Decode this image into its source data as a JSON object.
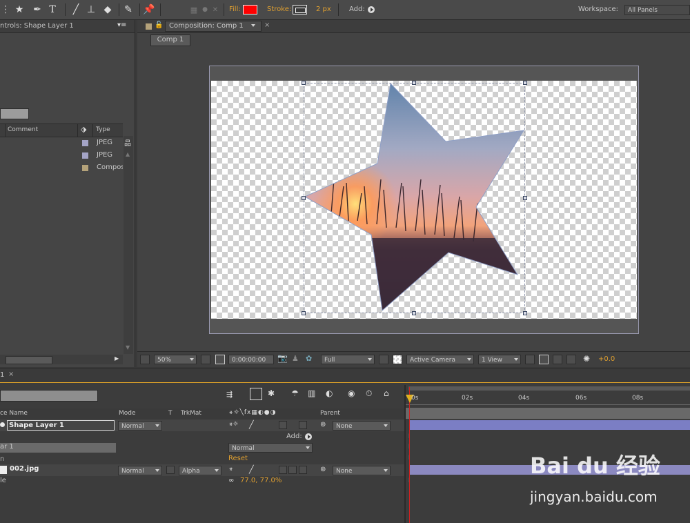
{
  "toolbar": {
    "fill_label": "Fill:",
    "fill_color": "#ff0000",
    "stroke_label": "Stroke:",
    "stroke_width": "2 px",
    "add_label": "Add:",
    "workspace_label": "Workspace:",
    "workspace_value": "All Panels",
    "tools": [
      "star-tool-icon",
      "pen-tool-icon",
      "type-tool-icon",
      "brush-tool-icon",
      "clone-stamp-icon",
      "eraser-icon",
      "roto-brush-icon",
      "puppet-pin-icon"
    ]
  },
  "effect_controls": {
    "title": "ntrols: Shape Layer 1"
  },
  "project": {
    "columns": {
      "comment": "Comment",
      "type": "Type"
    },
    "items": [
      {
        "type": "JPEG",
        "color": "#a4a4c6"
      },
      {
        "type": "JPEG",
        "color": "#a4a4c6"
      },
      {
        "type": "Compos",
        "color": "#b4a27a"
      }
    ]
  },
  "composition": {
    "tab_title": "Composition: Comp 1",
    "breadcrumb": "Comp 1",
    "zoom": "50%",
    "timecode": "0:00:00:00",
    "resolution": "Full",
    "camera": "Active Camera",
    "view": "1 View",
    "exposure": "+0.0"
  },
  "timeline": {
    "tab": "1",
    "headers": {
      "name": "ce Name",
      "mode": "Mode",
      "t": "T",
      "trkmat": "TrkMat",
      "parent": "Parent"
    },
    "layers": [
      {
        "name": "Shape Layer 1",
        "mode": "Normal",
        "parent": "None"
      },
      {
        "name": "002.jpg",
        "mode": "Normal",
        "trkmat": "Alpha",
        "parent": "None"
      }
    ],
    "add_label": "Add:",
    "sub_row_label": "ar 1",
    "sub_row_mode": "Normal",
    "reset_label": "Reset",
    "scale_label": "le",
    "scale_value": "77.0, 77.0%",
    "ruler": [
      "0s",
      "02s",
      "04s",
      "06s",
      "08s"
    ]
  },
  "watermark": {
    "brand": "Bai du 经验",
    "url": "jingyan.baidu.com"
  }
}
